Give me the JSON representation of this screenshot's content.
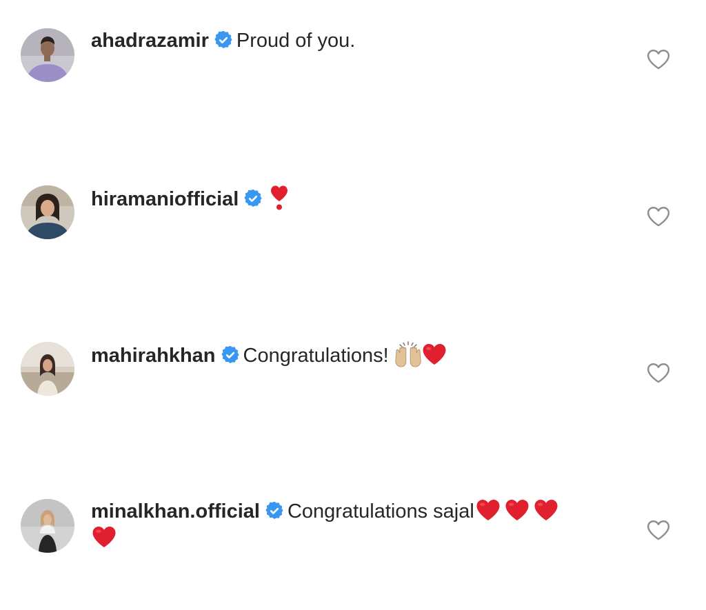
{
  "comments": [
    {
      "username": "ahadrazamir",
      "verified_icon": "verified-badge-icon",
      "text": "Proud of you.",
      "emojis": [],
      "avatar_icon": "avatar-photo",
      "like_icon": "heart-outline-icon"
    },
    {
      "username": "hiramaniofficial",
      "verified_icon": "verified-badge-icon",
      "text": "",
      "emojis": [
        "heavy-heart-exclamation-icon"
      ],
      "avatar_icon": "avatar-photo",
      "like_icon": "heart-outline-icon"
    },
    {
      "username": "mahirahkhan",
      "verified_icon": "verified-badge-icon",
      "text": "Congratulations!",
      "emojis": [
        "raising-hands-icon",
        "red-heart-icon"
      ],
      "avatar_icon": "avatar-photo",
      "like_icon": "heart-outline-icon"
    },
    {
      "username": "minalkhan.official",
      "verified_icon": "verified-badge-icon",
      "text": "Congratulations sajal",
      "emojis": [
        "red-heart-icon",
        "red-heart-icon",
        "red-heart-icon",
        "red-heart-icon"
      ],
      "avatar_icon": "avatar-photo",
      "like_icon": "heart-outline-icon"
    }
  ],
  "colors": {
    "text": "#262626",
    "verified_blue": "#3897f0",
    "heart_red": "#e0202e",
    "like_outline": "#8e8e8e",
    "background": "#ffffff"
  }
}
